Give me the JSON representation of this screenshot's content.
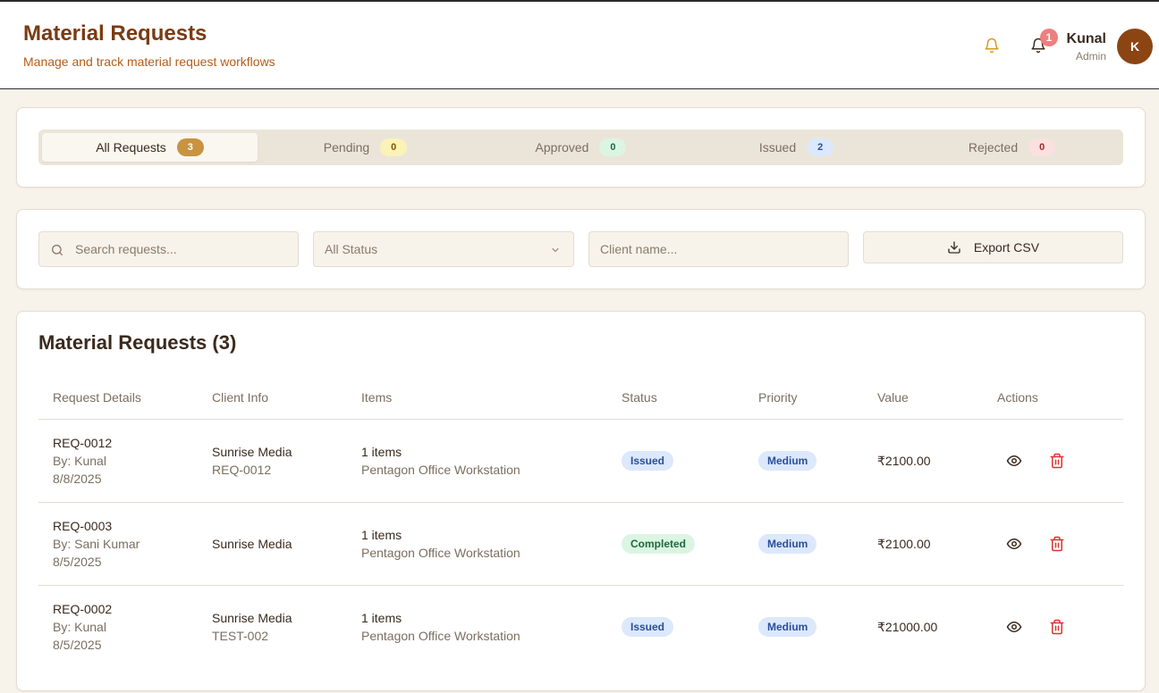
{
  "header": {
    "title": "Material Requests",
    "subtitle": "Manage and track material request workflows",
    "notification_count": "1",
    "user_name": "Kunal",
    "user_role": "Admin",
    "avatar_initial": "K"
  },
  "tabs": [
    {
      "label": "All Requests",
      "count": "3"
    },
    {
      "label": "Pending",
      "count": "0"
    },
    {
      "label": "Approved",
      "count": "0"
    },
    {
      "label": "Issued",
      "count": "2"
    },
    {
      "label": "Rejected",
      "count": "0"
    }
  ],
  "filters": {
    "search_placeholder": "Search requests...",
    "status_selected": "All Status",
    "client_placeholder": "Client name...",
    "export_label": "Export CSV"
  },
  "table": {
    "title": "Material Requests (3)",
    "columns": [
      "Request Details",
      "Client Info",
      "Items",
      "Status",
      "Priority",
      "Value",
      "Actions"
    ],
    "rows": [
      {
        "id": "REQ-0012",
        "by": "By: Kunal",
        "date": "8/8/2025",
        "client": "Sunrise Media",
        "client_ref": "REQ-0012",
        "items": "1 items",
        "item_name": "Pentagon Office Workstation",
        "status": "Issued",
        "priority": "Medium",
        "value": "₹2100.00"
      },
      {
        "id": "REQ-0003",
        "by": "By: Sani Kumar",
        "date": "8/5/2025",
        "client": "Sunrise Media",
        "client_ref": "",
        "items": "1 items",
        "item_name": "Pentagon Office Workstation",
        "status": "Completed",
        "priority": "Medium",
        "value": "₹2100.00"
      },
      {
        "id": "REQ-0002",
        "by": "By: Kunal",
        "date": "8/5/2025",
        "client": "Sunrise Media",
        "client_ref": "TEST-002",
        "items": "1 items",
        "item_name": "Pentagon Office Workstation",
        "status": "Issued",
        "priority": "Medium",
        "value": "₹21000.00"
      }
    ]
  },
  "colors": {
    "accent": "#8b4513",
    "title": "#7a3b12",
    "delete": "#e03131"
  },
  "icons": {
    "search": "search-icon",
    "bell": "bell-icon",
    "chevron": "chevron-down-icon",
    "download": "download-icon",
    "view": "eye-icon",
    "delete": "trash-icon"
  }
}
